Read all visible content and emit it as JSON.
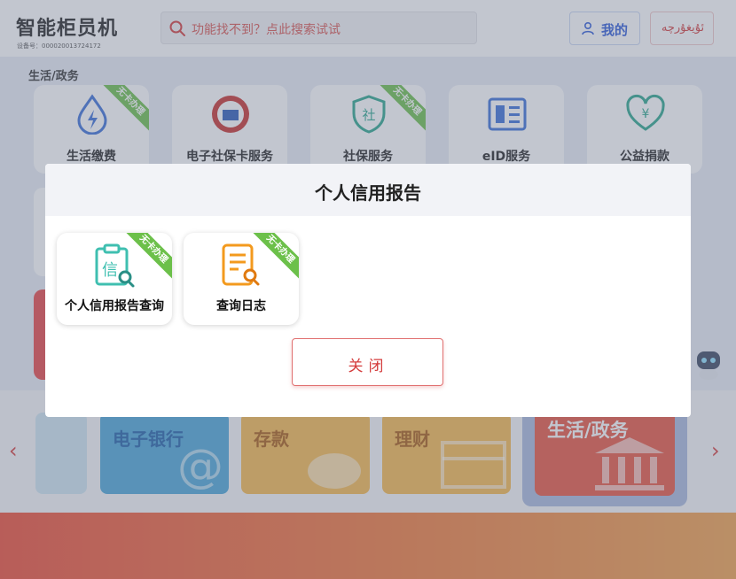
{
  "header": {
    "app_title": "智能柜员机",
    "device_no": "设备号：000020013724172",
    "search_placeholder": "功能找不到？点此搜索试试",
    "mine_label": "我的",
    "lang_label": "ئۇيغۇرچە"
  },
  "section": {
    "label": "生活/政务"
  },
  "tiles": [
    {
      "label": "生活缴费",
      "badge": "无卡办理",
      "icon": "lightning-drop-icon"
    },
    {
      "label": "电子社保卡服务",
      "badge": "",
      "icon": "social-security-card-logo"
    },
    {
      "label": "社保服务",
      "badge": "无卡办理",
      "icon": "shield-she-icon"
    },
    {
      "label": "eID服务",
      "badge": "",
      "icon": "eid-card-icon"
    },
    {
      "label": "公益捐款",
      "badge": "",
      "icon": "heart-yuan-icon"
    }
  ],
  "banners": [
    {
      "label": "电子银行"
    },
    {
      "label": "存款"
    },
    {
      "label": "理财"
    },
    {
      "label": "生活/政务"
    }
  ],
  "modal": {
    "title": "个人信用报告",
    "items": [
      {
        "label": "个人信用报告查询",
        "badge": "无卡办理",
        "icon": "credit-report-search-icon"
      },
      {
        "label": "查询日志",
        "badge": "无卡办理",
        "icon": "query-log-icon"
      }
    ],
    "close_label": "关闭"
  },
  "colors": {
    "accent_red": "#d43c3c",
    "badge_green": "#6cc04a",
    "brand_blue": "#2e5bd8"
  }
}
